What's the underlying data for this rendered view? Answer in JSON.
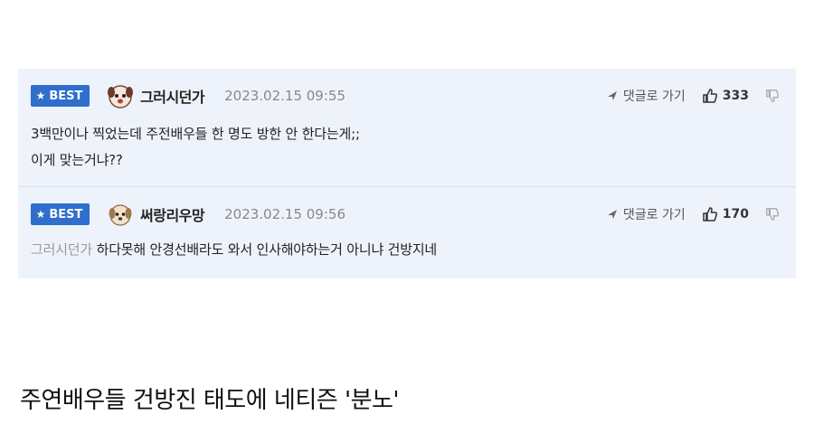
{
  "comments": [
    {
      "badge": "BEST",
      "nickname": "그러시던가",
      "date": "2023.02.15 09:55",
      "reply_label": "댓글로 가기",
      "likes": "333",
      "lines": [
        "3백만이나 찍었는데 주전배우들 한 명도 방한 안 한다는게;;",
        "이게 맞는거냐??"
      ]
    },
    {
      "badge": "BEST",
      "nickname": "써랑리우망",
      "date": "2023.02.15 09:56",
      "reply_label": "댓글로 가기",
      "likes": "170",
      "mention": "그러시던가",
      "text": "하다못해 안경선배라도 와서 인사해야하는거 아니냐 건방지네"
    }
  ],
  "headline": "주연배우들 건방진 태도에 네티즌 '분노'",
  "colors": {
    "badge": "#2f6ecc",
    "panel": "#eef3fb",
    "muted": "#888888"
  }
}
